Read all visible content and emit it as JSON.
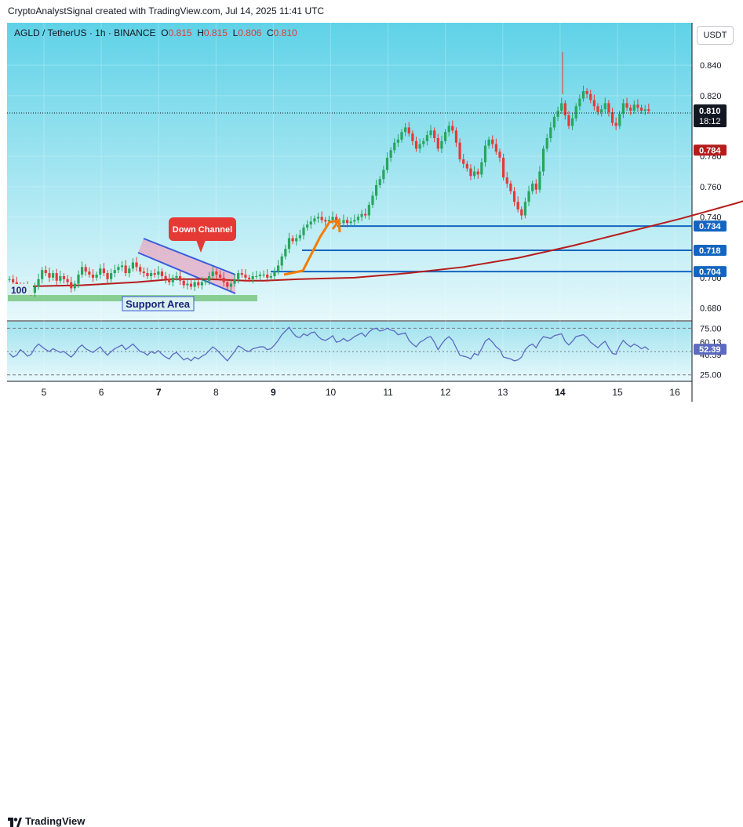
{
  "header": {
    "credit": "CryptoAnalystSignal created with TradingView.com, Jul 14, 2025 11:41 UTC"
  },
  "legend": {
    "symbol": "AGLD / TetherUS · 1h · BINANCE",
    "o_label": "O",
    "o": "0.815",
    "h_label": "H",
    "h": "0.815",
    "l_label": "L",
    "l": "0.806",
    "c_label": "C",
    "c": "0.810"
  },
  "currency_button": "USDT",
  "footer": {
    "brand": "TradingView"
  },
  "colors": {
    "bg_top": "#62d3e8",
    "bg_bottom": "#e4f8fb",
    "candle_up": "#26a65b",
    "candle_down": "#e53935",
    "ma": "#b71c1c",
    "level_line": "#1565c0",
    "channel": "#3b5bdb",
    "support": "#6cc070",
    "orange": "#f57c00",
    "rsi": "#5c6bc0"
  },
  "annotations": {
    "down_channel": "Down Channel",
    "support_area": "Support Area",
    "label_100": "100"
  },
  "chart_data": {
    "type": "candlestick",
    "x_ticks": [
      "5",
      "6",
      "7",
      "8",
      "9",
      "10",
      "11",
      "12",
      "13",
      "14",
      "15",
      "16"
    ],
    "y_ticks": [
      "0.840",
      "0.820",
      "0.780",
      "0.760",
      "0.740",
      "0.700",
      "0.680"
    ],
    "ylim": [
      0.672,
      0.868
    ],
    "current_price": "0.810",
    "countdown": "18:12",
    "ma_value": "0.784",
    "levels": [
      "0.734",
      "0.718",
      "0.704"
    ],
    "ma_points": [
      [
        0,
        0.694
      ],
      [
        20,
        0.695
      ],
      [
        35,
        0.697
      ],
      [
        45,
        0.699
      ],
      [
        55,
        0.699
      ],
      [
        65,
        0.698
      ],
      [
        70,
        0.698
      ],
      [
        80,
        0.699
      ],
      [
        95,
        0.7
      ],
      [
        110,
        0.703
      ],
      [
        125,
        0.707
      ],
      [
        140,
        0.713
      ],
      [
        155,
        0.721
      ],
      [
        170,
        0.73
      ],
      [
        185,
        0.739
      ],
      [
        200,
        0.749
      ],
      [
        215,
        0.76
      ],
      [
        225,
        0.768
      ],
      [
        235,
        0.776
      ],
      [
        246,
        0.784
      ]
    ],
    "candle_closes": [
      0.699,
      0.697,
      0.695,
      0.692,
      0.694,
      0.692,
      0.69,
      0.694,
      0.699,
      0.705,
      0.703,
      0.7,
      0.703,
      0.698,
      0.701,
      0.699,
      0.697,
      0.693,
      0.696,
      0.702,
      0.707,
      0.704,
      0.702,
      0.7,
      0.702,
      0.706,
      0.703,
      0.699,
      0.703,
      0.705,
      0.707,
      0.708,
      0.703,
      0.706,
      0.71,
      0.707,
      0.704,
      0.703,
      0.701,
      0.703,
      0.702,
      0.704,
      0.701,
      0.699,
      0.697,
      0.7,
      0.701,
      0.698,
      0.695,
      0.696,
      0.694,
      0.697,
      0.695,
      0.697,
      0.698,
      0.701,
      0.704,
      0.702,
      0.7,
      0.697,
      0.694,
      0.696,
      0.699,
      0.703,
      0.702,
      0.7,
      0.699,
      0.701,
      0.701,
      0.702,
      0.702,
      0.7,
      0.701,
      0.704,
      0.708,
      0.714,
      0.719,
      0.726,
      0.724,
      0.726,
      0.728,
      0.733,
      0.735,
      0.737,
      0.739,
      0.74,
      0.738,
      0.737,
      0.738,
      0.74,
      0.736,
      0.736,
      0.738,
      0.736,
      0.737,
      0.738,
      0.74,
      0.742,
      0.741,
      0.748,
      0.754,
      0.761,
      0.765,
      0.771,
      0.779,
      0.784,
      0.789,
      0.791,
      0.796,
      0.799,
      0.795,
      0.79,
      0.785,
      0.788,
      0.79,
      0.794,
      0.797,
      0.792,
      0.785,
      0.79,
      0.796,
      0.8,
      0.797,
      0.789,
      0.778,
      0.775,
      0.772,
      0.767,
      0.77,
      0.768,
      0.776,
      0.787,
      0.791,
      0.788,
      0.783,
      0.779,
      0.766,
      0.762,
      0.757,
      0.75,
      0.745,
      0.741,
      0.75,
      0.757,
      0.762,
      0.758,
      0.77,
      0.785,
      0.792,
      0.799,
      0.806,
      0.81,
      0.815,
      0.807,
      0.8,
      0.805,
      0.813,
      0.818,
      0.823,
      0.821,
      0.817,
      0.813,
      0.809,
      0.811,
      0.815,
      0.809,
      0.802,
      0.8,
      0.808,
      0.815,
      0.812,
      0.81,
      0.814,
      0.812,
      0.81,
      0.811,
      0.81
    ],
    "rsi": {
      "ticks": [
        "75.00",
        "60.13",
        "46.59",
        "25.00"
      ],
      "current": "52.39",
      "values": [
        48,
        44,
        46,
        52,
        49,
        45,
        47,
        54,
        58,
        55,
        52,
        50,
        53,
        51,
        49,
        50,
        47,
        44,
        48,
        54,
        57,
        53,
        51,
        49,
        52,
        55,
        50,
        46,
        50,
        53,
        55,
        57,
        52,
        55,
        58,
        54,
        50,
        49,
        46,
        50,
        48,
        51,
        47,
        44,
        42,
        47,
        49,
        45,
        41,
        43,
        40,
        44,
        42,
        45,
        47,
        51,
        55,
        52,
        48,
        44,
        40,
        45,
        50,
        56,
        54,
        51,
        50,
        53,
        54,
        55,
        55,
        52,
        53,
        57,
        62,
        68,
        72,
        76,
        70,
        66,
        65,
        69,
        67,
        70,
        71,
        66,
        63,
        62,
        64,
        67,
        60,
        61,
        64,
        61,
        63,
        66,
        68,
        70,
        66,
        71,
        74,
        75,
        72,
        73,
        75,
        73,
        72,
        68,
        69,
        70,
        62,
        58,
        55,
        60,
        62,
        65,
        66,
        60,
        52,
        58,
        63,
        66,
        62,
        54,
        46,
        45,
        44,
        42,
        48,
        46,
        53,
        61,
        64,
        60,
        55,
        52,
        44,
        43,
        42,
        40,
        41,
        44,
        52,
        56,
        58,
        54,
        61,
        66,
        65,
        64,
        67,
        68,
        69,
        61,
        57,
        61,
        66,
        67,
        68,
        65,
        60,
        57,
        54,
        58,
        61,
        54,
        48,
        47,
        56,
        62,
        58,
        55,
        58,
        56,
        53,
        55,
        52
      ]
    }
  }
}
